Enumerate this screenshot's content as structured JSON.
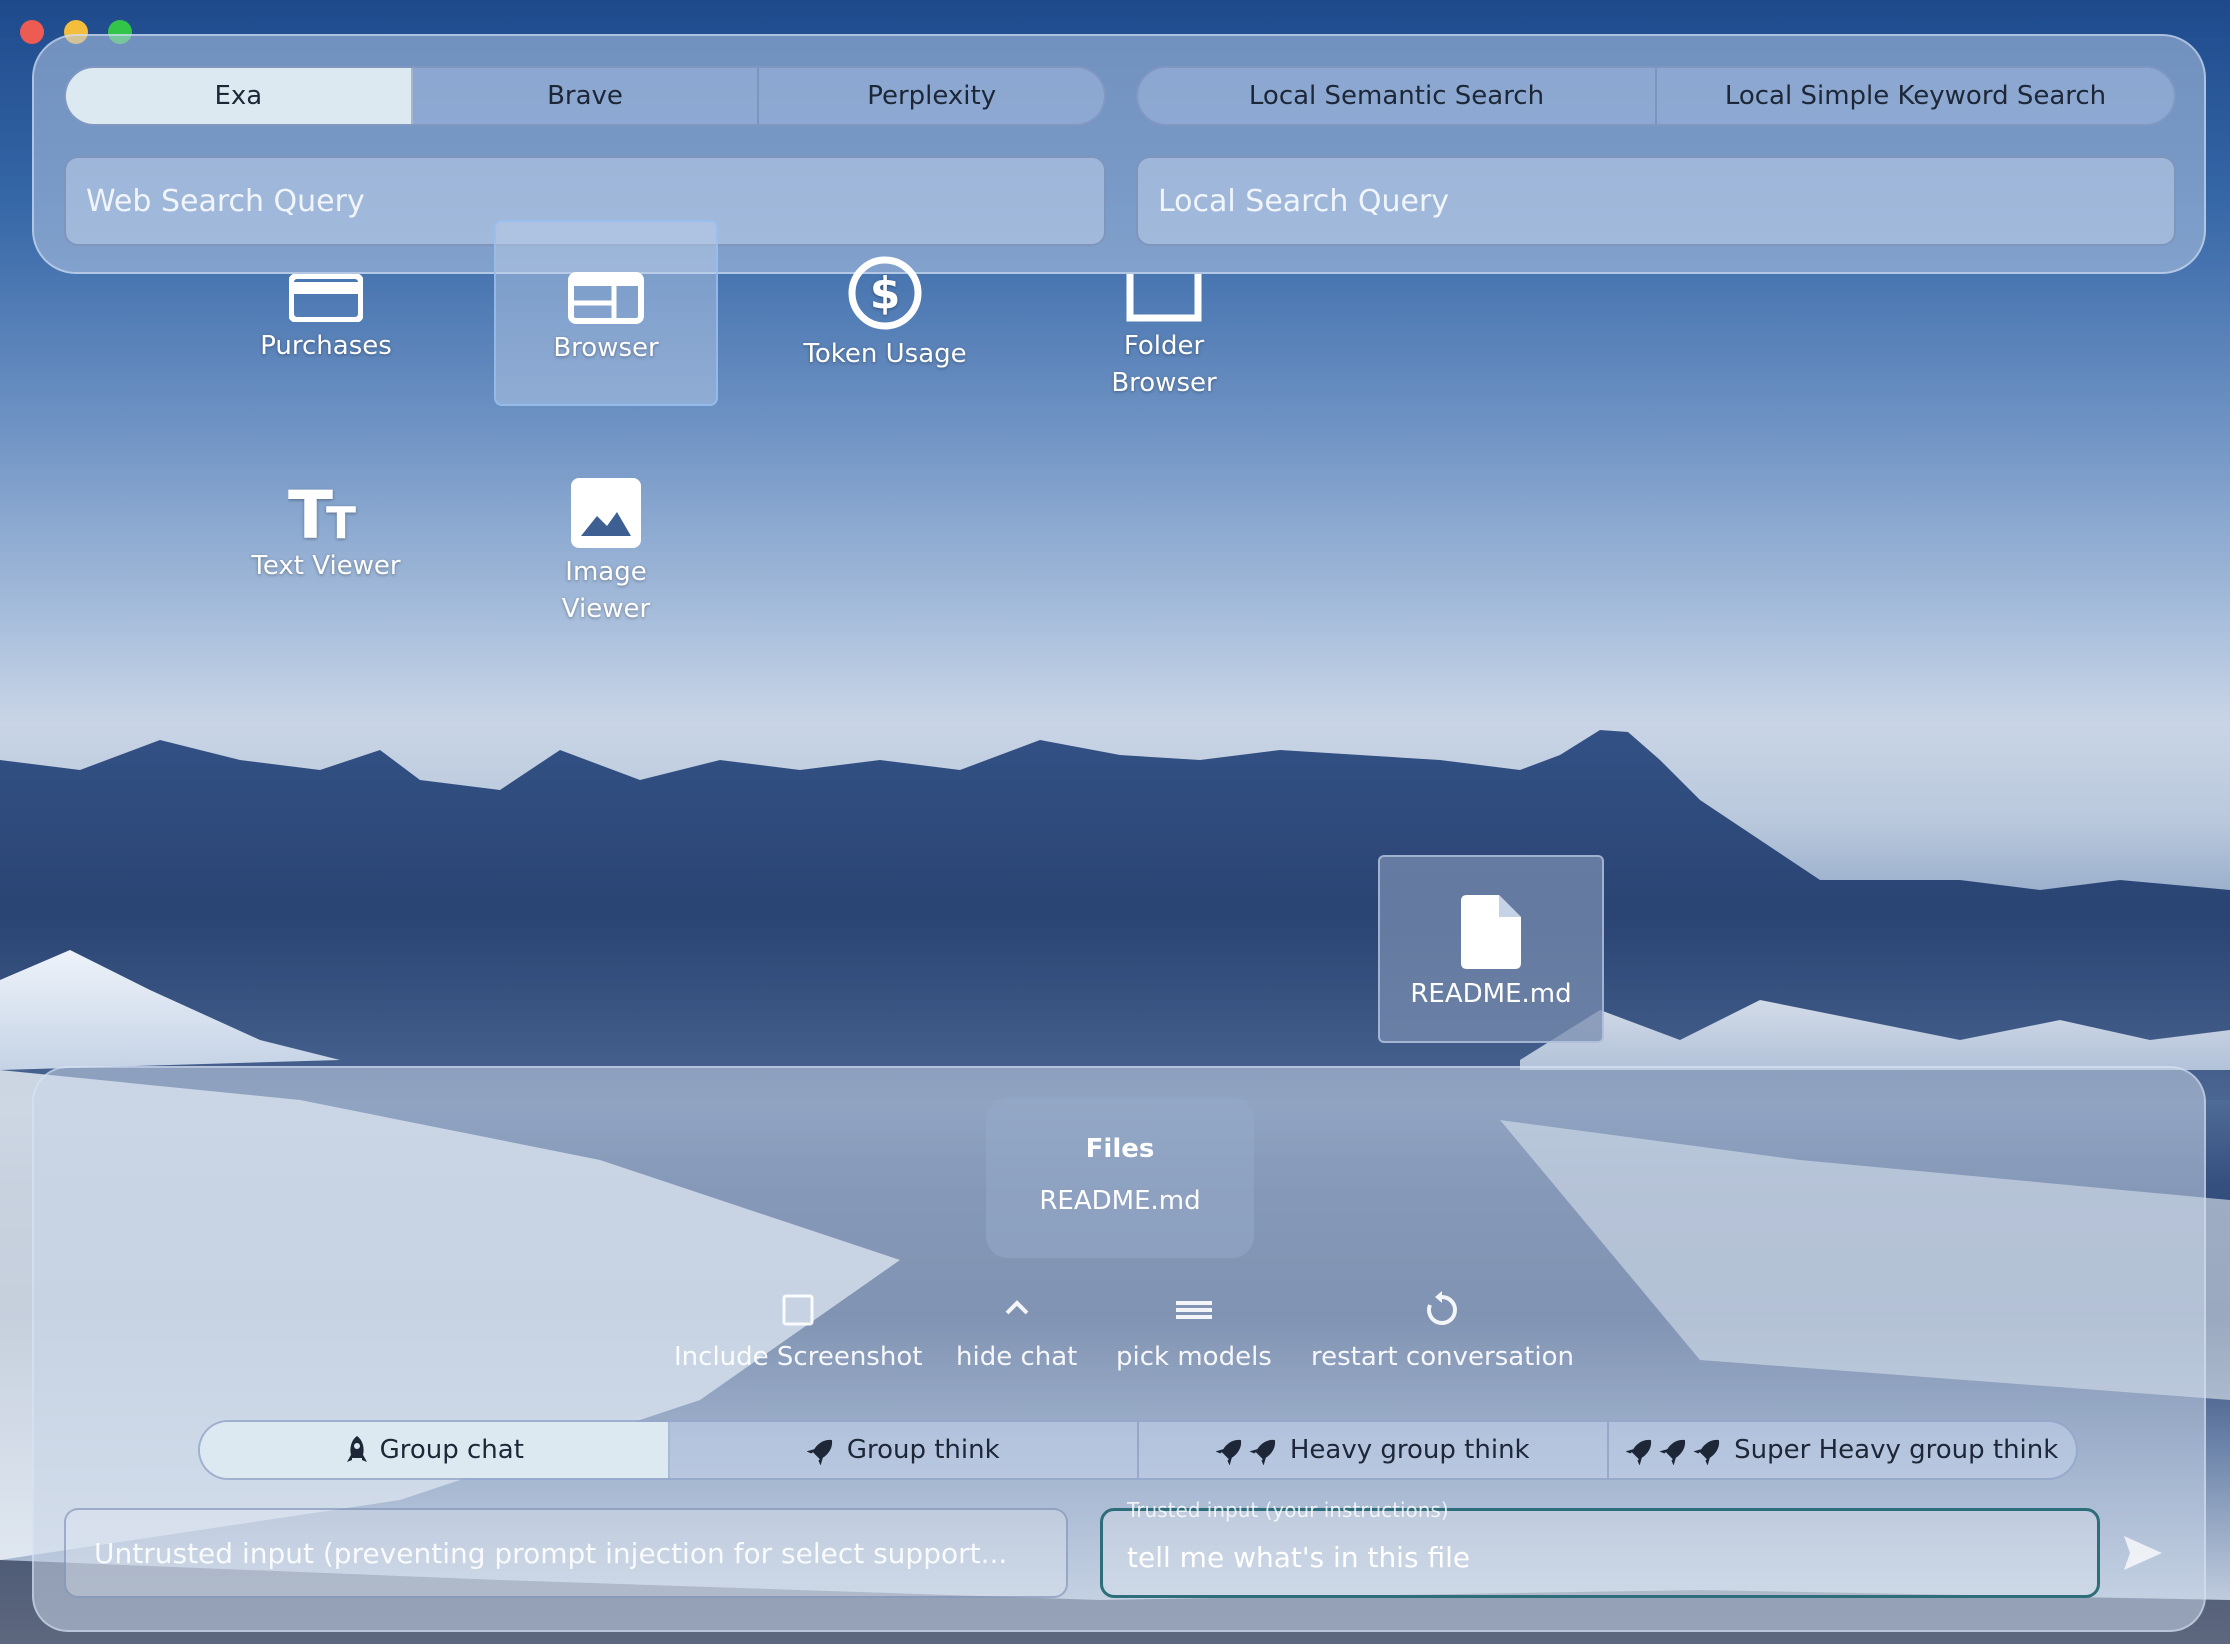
{
  "window": {
    "traffic_lights": [
      "close",
      "minimize",
      "maximize"
    ]
  },
  "web_search": {
    "providers": [
      "Exa",
      "Brave",
      "Perplexity"
    ],
    "active_provider": "Exa",
    "placeholder": "Web Search Query",
    "value": ""
  },
  "local_search": {
    "modes": [
      "Local Semantic Search",
      "Local Simple Keyword Search"
    ],
    "placeholder": "Local Search Query",
    "value": ""
  },
  "desktop_icons": [
    {
      "label": "Purchases",
      "icon": "credit-card-icon"
    },
    {
      "label": "Browser",
      "icon": "browser-window-icon",
      "selected": true
    },
    {
      "label": "Token Usage",
      "icon": "dollar-circle-icon"
    },
    {
      "label": "Folder\nBrowser",
      "icon": "folder-icon"
    },
    {
      "label": "Text Viewer",
      "icon": "text-size-icon"
    },
    {
      "label": "Image\nViewer",
      "icon": "image-icon"
    }
  ],
  "file_icon": {
    "label": "README.md",
    "icon": "file-icon"
  },
  "chat": {
    "files_title": "Files",
    "files": [
      "README.md"
    ],
    "tools": [
      {
        "label": "Include Screenshot",
        "icon": "checkbox-icon"
      },
      {
        "label": "hide chat",
        "icon": "chevron-up-icon"
      },
      {
        "label": "pick models",
        "icon": "list-icon"
      },
      {
        "label": "restart conversation",
        "icon": "restart-icon"
      }
    ],
    "modes": [
      {
        "label": "Group chat",
        "icon": "rocket-icon",
        "count": 1
      },
      {
        "label": "Group think",
        "icon": "rocket-icon",
        "count": 1
      },
      {
        "label": "Heavy group think",
        "icon": "rocket-icon",
        "count": 2
      },
      {
        "label": "Super Heavy group think",
        "icon": "rocket-icon",
        "count": 3
      }
    ],
    "active_mode": "Group chat",
    "untrusted_placeholder": "Untrusted input (preventing prompt injection for select support...",
    "trusted_label": "Trusted input (your instructions)",
    "trusted_value": "tell me what's in this file",
    "send_icon": "send-icon"
  },
  "colors": {
    "accent_active": "#dce9f0",
    "trusted_border": "#2e6e7a",
    "text_dark": "#1d2738"
  }
}
